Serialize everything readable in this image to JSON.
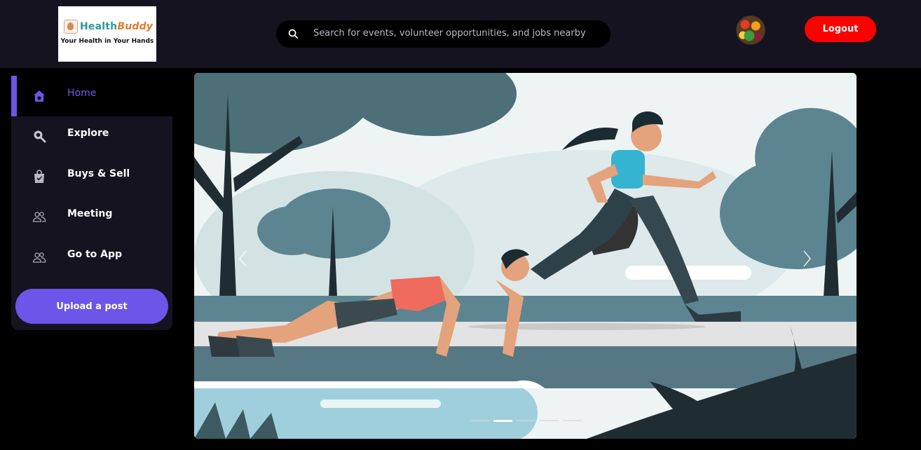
{
  "header": {
    "logo": {
      "name_part1": "Health",
      "name_part2": "Buddy",
      "tagline": "Your Health in Your Hands"
    },
    "search": {
      "placeholder": "Search for events, volunteer opportunities, and jobs nearby",
      "icon": "search-icon"
    },
    "avatar": {
      "icon": "user-avatar"
    },
    "logout_label": "Logout"
  },
  "sidebar": {
    "items": [
      {
        "label": "Home",
        "icon": "home-icon",
        "active": true
      },
      {
        "label": "Explore",
        "icon": "explore-icon",
        "active": false
      },
      {
        "label": "Buys & Sell",
        "icon": "shopping-bag-icon",
        "active": false
      },
      {
        "label": "Meeting",
        "icon": "users-icon",
        "active": false
      },
      {
        "label": "Go to App",
        "icon": "users-icon",
        "active": false
      }
    ],
    "upload_label": "Upload a post"
  },
  "carousel": {
    "slide_count": 5,
    "active_slide": 2,
    "prev_icon": "chevron-left-icon",
    "next_icon": "chevron-right-icon"
  },
  "colors": {
    "accent": "#6c55e8",
    "logout": "#ff0000",
    "header_bg": "#15131f",
    "page_bg": "#000000"
  }
}
